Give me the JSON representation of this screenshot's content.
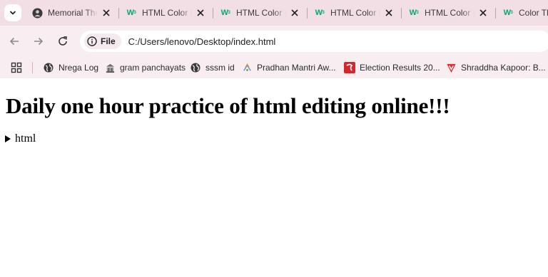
{
  "tabs": [
    {
      "title": "Memorial The",
      "favicon": "memorial-favicon-icon"
    },
    {
      "title": "HTML Color N",
      "favicon": "w3schools-icon"
    },
    {
      "title": "HTML Color N",
      "favicon": "w3schools-icon"
    },
    {
      "title": "HTML Color N",
      "favicon": "w3schools-icon"
    },
    {
      "title": "HTML Color N",
      "favicon": "w3schools-icon"
    },
    {
      "title": "Color Th",
      "favicon": "w3schools-icon"
    }
  ],
  "w3_logo_text": "W",
  "w3_logo_sup": "3",
  "toolbar": {
    "chip_label": "File",
    "url": "C:/Users/lenovo/Desktop/index.html"
  },
  "bookmarks": [
    {
      "label": "Nrega Log",
      "icon": "globe-icon"
    },
    {
      "label": "gram panchayats",
      "icon": "building-icon"
    },
    {
      "label": "sssm id",
      "icon": "globe-icon"
    },
    {
      "label": "Pradhan Mantri Aw...",
      "icon": "pmay-icon"
    },
    {
      "label": "Election Results 20...",
      "icon": "election-icon"
    },
    {
      "label": "Shraddha Kapoor: B...",
      "icon": "vivaldi-icon"
    }
  ],
  "page": {
    "heading": "Daily one hour practice of html editing online!!!",
    "details_summary": "html"
  },
  "colors": {
    "tabstrip": "#f2dfe6",
    "toolbar": "#f8eef2",
    "w3_green": "#04aa6d"
  }
}
